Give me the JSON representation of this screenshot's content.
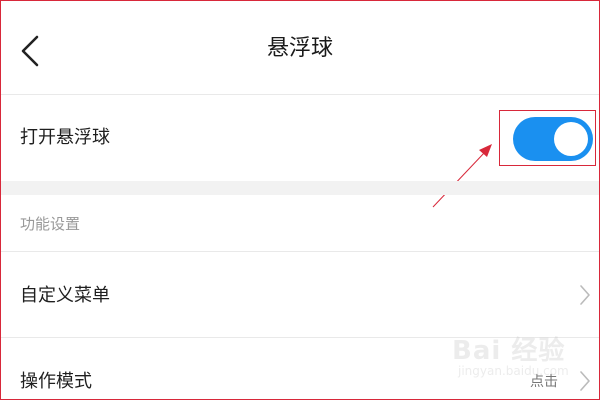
{
  "header": {
    "title": "悬浮球",
    "back_icon": "chevron-left-icon"
  },
  "toggle_row": {
    "label": "打开悬浮球",
    "enabled": true,
    "accent_color": "#1a90f0"
  },
  "section": {
    "label": "功能设置"
  },
  "menu_row": {
    "label": "自定义菜单",
    "chevron_icon": "chevron-right-icon"
  },
  "mode_row": {
    "label": "操作模式",
    "value": "点击",
    "chevron_icon": "chevron-right-icon"
  },
  "annotation": {
    "color": "#d8283a"
  },
  "watermark": {
    "main": "Bai 经验",
    "sub": "jingyan.baidu.com"
  }
}
